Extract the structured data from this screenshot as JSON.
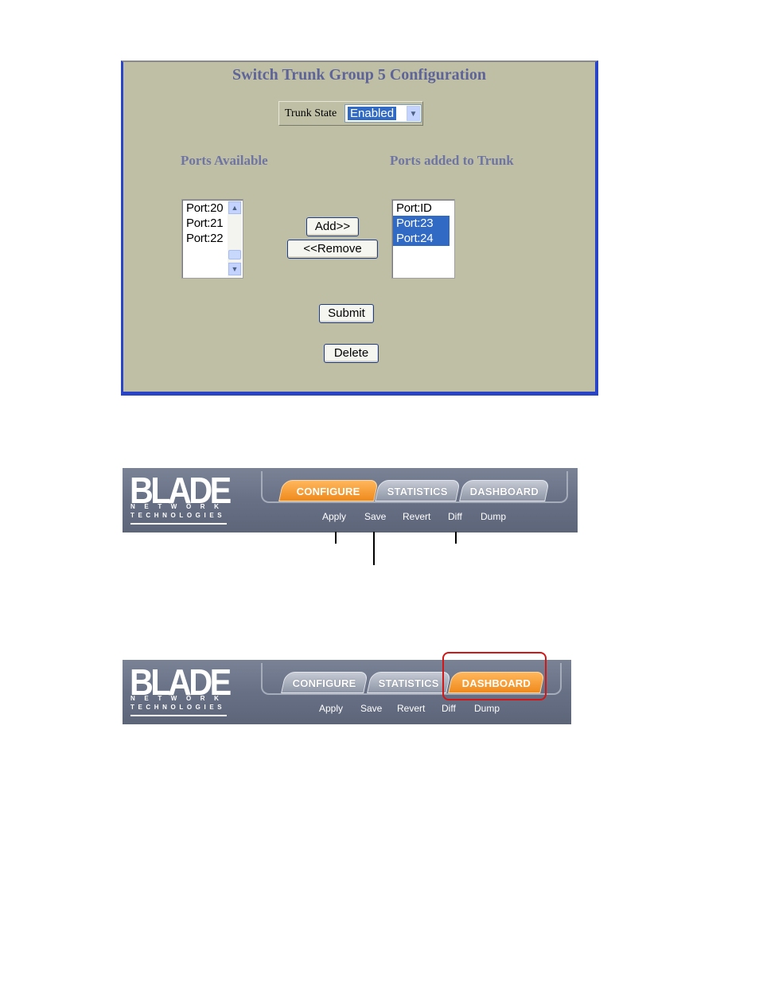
{
  "trunk_config": {
    "title": "Switch Trunk Group 5 Configuration",
    "trunk_state_label": "Trunk State",
    "trunk_state_value": "Enabled",
    "ports_available_heading": "Ports Available",
    "ports_added_heading": "Ports added to Trunk",
    "ports_available": [
      "Port:20",
      "Port:21",
      "Port:22"
    ],
    "ports_added": [
      {
        "label": "Port:ID",
        "selected": false
      },
      {
        "label": "Port:23",
        "selected": true
      },
      {
        "label": "Port:24",
        "selected": true
      }
    ],
    "add_label": "Add>>",
    "remove_label": "<<Remove",
    "submit_label": "Submit",
    "delete_label": "Delete"
  },
  "navbar_1": {
    "logo": {
      "word": "BLADE",
      "network": "NETWORK",
      "technologies": "TECHNOLOGIES"
    },
    "tabs": [
      {
        "label": "CONFIGURE",
        "active": true
      },
      {
        "label": "STATISTICS",
        "active": false
      },
      {
        "label": "DASHBOARD",
        "active": false
      }
    ],
    "actions": [
      "Apply",
      "Save",
      "Revert",
      "Diff",
      "Dump"
    ]
  },
  "navbar_2": {
    "logo": {
      "word": "BLADE",
      "network": "NETWORK",
      "technologies": "TECHNOLOGIES"
    },
    "tabs": [
      {
        "label": "CONFIGURE",
        "active": false
      },
      {
        "label": "STATISTICS",
        "active": false
      },
      {
        "label": "DASHBOARD",
        "active": true
      }
    ],
    "actions": [
      "Apply",
      "Save",
      "Revert",
      "Diff",
      "Dump"
    ]
  },
  "colors": {
    "panel_bg": "#bfbfa6",
    "panel_border": "#2a44c8",
    "heading": "#5e6498",
    "selection": "#316ac5",
    "tab_active": "#ef8a1c",
    "nav_bg": "#677085",
    "highlight": "#d01818"
  },
  "icons": [
    "chevron-down-icon",
    "scroll-up-icon",
    "scroll-down-icon"
  ]
}
